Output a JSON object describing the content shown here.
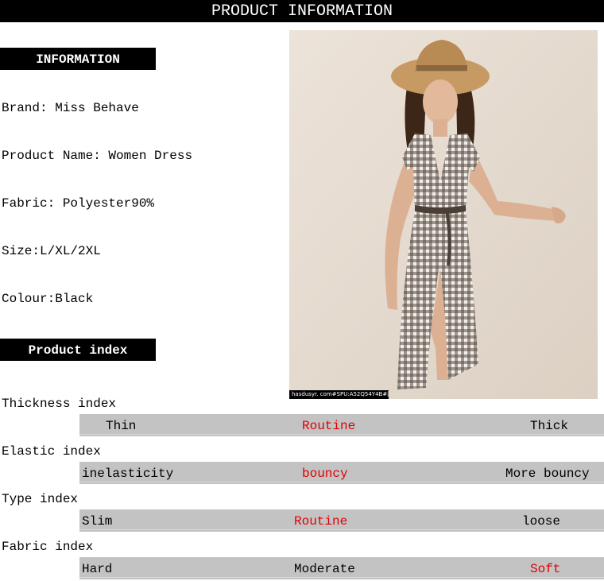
{
  "header": {
    "title": "PRODUCT INFORMATION"
  },
  "information": {
    "label": "INFORMATION",
    "brand": "Brand:  Miss Behave",
    "product_name": "Product Name: Women Dress",
    "fabric": "Fabric: Polyester90%",
    "size": "Size:L/XL/2XL",
    "colour": "Colour:Black"
  },
  "photo": {
    "caption": "hasdusyr. com#SPU:A52Q54Y4B#网络图",
    "description_icon": "model-gingham-dress-icon"
  },
  "product_index": {
    "label": "Product index",
    "rows": [
      {
        "title": "Thickness index",
        "options": [
          "Thin",
          "Routine",
          "Thick"
        ],
        "selected": 1
      },
      {
        "title": "Elastic index",
        "options": [
          "inelasticity",
          "bouncy",
          "More bouncy"
        ],
        "selected": 1
      },
      {
        "title": "Type index",
        "options": [
          "Slim",
          "Routine",
          "loose"
        ],
        "selected": 1
      },
      {
        "title": "Fabric index",
        "options": [
          "Hard",
          "Moderate",
          "Soft"
        ],
        "selected": 2
      }
    ]
  },
  "colors": {
    "highlight": "#e00000",
    "bar": "#c3c3c3",
    "label_bg": "#000000"
  }
}
